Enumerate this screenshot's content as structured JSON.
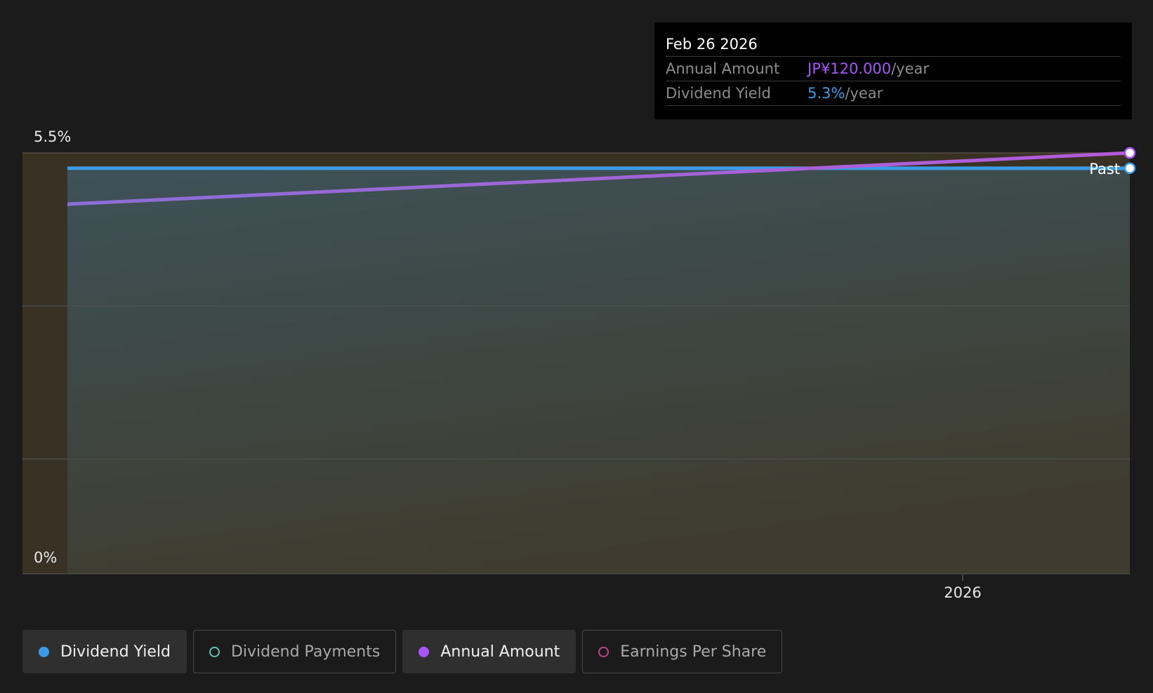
{
  "chart_data": {
    "type": "line",
    "title": "",
    "xlabel": "",
    "ylabel": "",
    "ylim": [
      0,
      5.5
    ],
    "y_unit": "%",
    "y_tick_labels": [
      "5.5%",
      "0%"
    ],
    "x_ticks": [
      {
        "value": "2026-01-01",
        "label": "2026"
      }
    ],
    "x_range": [
      "2025-03-07",
      "2026-02-26"
    ],
    "grid": true,
    "legend_position": "bottom",
    "series": [
      {
        "name": "Dividend Yield",
        "color": "#3b9be6",
        "unit": "%",
        "points": [
          {
            "x": "2025-03-07",
            "y": 5.3
          },
          {
            "x": "2026-02-26",
            "y": 5.3
          }
        ]
      },
      {
        "name": "Annual Amount",
        "color": "#a855f7",
        "unit": "JP¥",
        "points": [
          {
            "x": "2025-03-07",
            "y": 4.83
          },
          {
            "x": "2026-02-26",
            "y": 5.5
          }
        ]
      }
    ],
    "past_label": "Past"
  },
  "tooltip": {
    "date": "Feb 26 2026",
    "rows": [
      {
        "label": "Annual Amount",
        "value": "JP¥120.000",
        "suffix": "/year"
      },
      {
        "label": "Dividend Yield",
        "value": "5.3%",
        "suffix": "/year"
      }
    ]
  },
  "legend": {
    "items": [
      {
        "label": "Dividend Yield",
        "color": "#3b9be6",
        "active": true
      },
      {
        "label": "Dividend Payments",
        "color": "#5ec2b8",
        "active": false
      },
      {
        "label": "Annual Amount",
        "color": "#a855f7",
        "active": true
      },
      {
        "label": "Earnings Per Share",
        "color": "#c0448a",
        "active": false
      }
    ]
  }
}
